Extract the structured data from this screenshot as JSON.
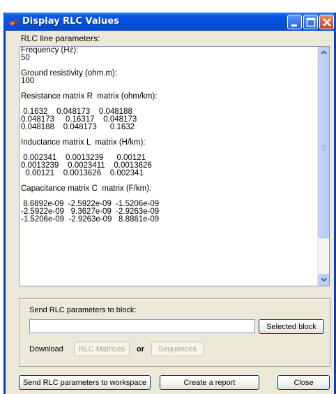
{
  "window": {
    "title": "Display RLC Values"
  },
  "rlc": {
    "section_label": "RLC line parameters:",
    "lines": [
      "Frequency (Hz):",
      "50",
      "",
      "Ground resistivity (ohm.m):",
      "100",
      "",
      "Resistance matrix R  matrix (ohm/km):",
      "",
      " 0.1632    0.048173    0.048188",
      "0.048173     0.16317    0.048173",
      "0.048188    0.048173      0.1632",
      "",
      "Inductance matrix L  matrix (H/km):",
      "",
      " 0.002341    0.0013239      0.00121",
      "0.0013239    0.0023411    0.0013626",
      "  0.00121    0.0013626    0.002341",
      "",
      "Capacitance matrix C  matrix (F/km):",
      "",
      " 8.6892e-09  -2.5922e-09  -1.5206e-09",
      "-2.5922e-09   9.3627e-09  -2.9263e-09",
      "-1.5206e-09  -2.9263e-09   8.8861e-09"
    ],
    "text": ""
  },
  "send_panel": {
    "label": "Send RLC parameters to block:",
    "input_value": "",
    "selected_block_label": "Selected block",
    "download_label": "Download",
    "rlc_matrices_label": "RLC Matrices",
    "or_label": "or",
    "sequences_label": "Sequences"
  },
  "bottom": {
    "workspace_label": "Send RLC parameters to workspace",
    "report_label": "Create a report",
    "close_label": "Close"
  },
  "colors": {
    "title_bar": "#0350d8",
    "window_bg": "#ece9d8",
    "close_button": "#c8401c"
  },
  "icons": {
    "app": "matlab-logo-icon",
    "minimize": "minimize-icon",
    "maximize": "maximize-icon",
    "close": "close-icon",
    "scroll_up": "chevron-up-icon",
    "scroll_down": "chevron-down-icon"
  }
}
